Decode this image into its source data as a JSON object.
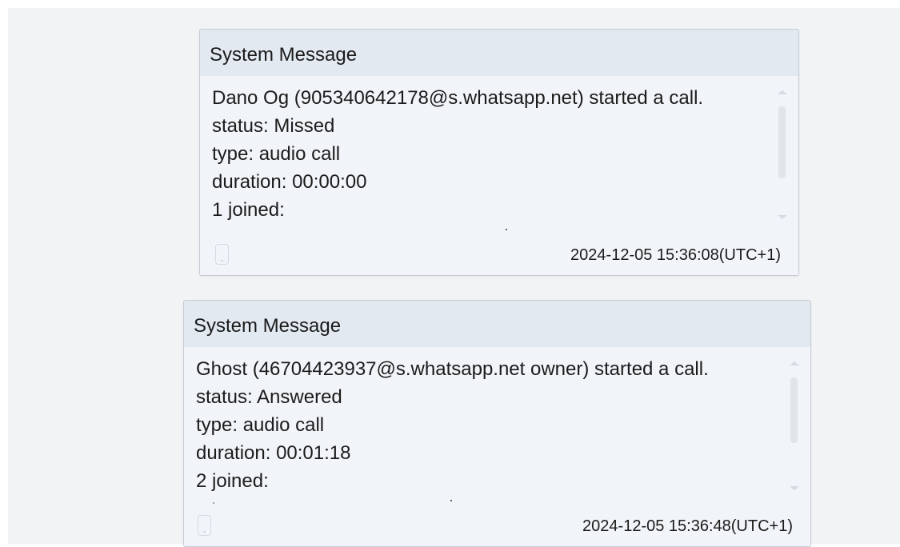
{
  "messages": [
    {
      "title": "System Message",
      "lines": [
        "Dano Og (905340642178@s.whatsapp.net) started a call.",
        "status: Missed",
        "type: audio call",
        "duration: 00:00:00",
        "1 joined:"
      ],
      "timestamp": "2024-12-05 15:36:08(UTC+1)",
      "icon": "phone-device-icon"
    },
    {
      "title": "System Message",
      "lines": [
        "Ghost (46704423937@s.whatsapp.net owner) started a call.",
        "status: Answered",
        "type: audio call",
        "duration: 00:01:18",
        "2 joined:"
      ],
      "timestamp": "2024-12-05 15:36:48(UTC+1)",
      "icon": "phone-device-icon"
    }
  ],
  "colors": {
    "background": "#f2f3f5",
    "card_bg": "#f1f4f8",
    "card_header_bg": "#e3e9f1",
    "card_border": "#c6ccd4",
    "text": "#1b1b1b"
  }
}
